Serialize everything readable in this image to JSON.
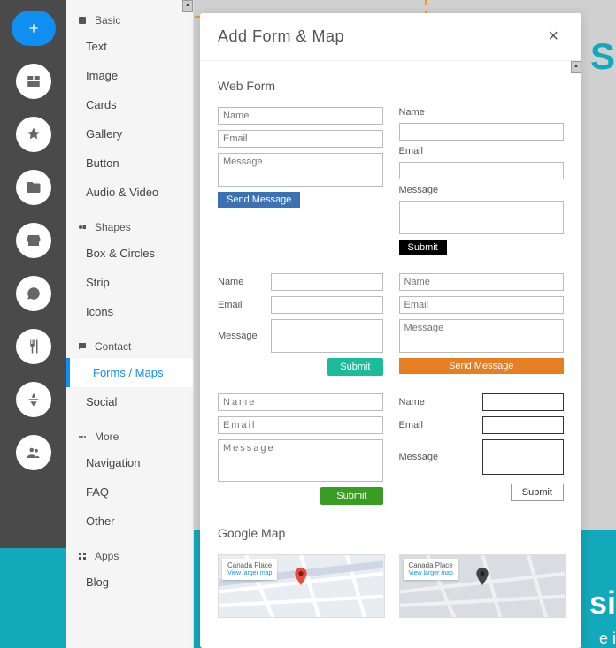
{
  "modal": {
    "title": "Add Form & Map",
    "close": "×",
    "section_webform": "Web Form",
    "section_map": "Google Map"
  },
  "form_labels": {
    "name": "Name",
    "email": "Email",
    "message": "Message",
    "send_message": "Send Message",
    "submit": "Submit"
  },
  "placeholders": {
    "name": "Name",
    "email": "Email",
    "message": "Message"
  },
  "map_card": {
    "place": "Canada Place",
    "view": "View larger map"
  },
  "sidebar": {
    "sections": [
      {
        "label": "Basic",
        "items": [
          {
            "label": "Text"
          },
          {
            "label": "Image"
          },
          {
            "label": "Cards"
          },
          {
            "label": "Gallery"
          },
          {
            "label": "Button"
          },
          {
            "label": "Audio & Video"
          }
        ]
      },
      {
        "label": "Shapes",
        "items": [
          {
            "label": "Box & Circles"
          },
          {
            "label": "Strip"
          },
          {
            "label": "Icons"
          }
        ]
      },
      {
        "label": "Contact",
        "items": [
          {
            "label": "Forms / Maps",
            "active": true
          },
          {
            "label": "Social"
          }
        ]
      },
      {
        "label": "More",
        "items": [
          {
            "label": "Navigation"
          },
          {
            "label": "FAQ"
          },
          {
            "label": "Other"
          }
        ]
      },
      {
        "label": "Apps",
        "items": [
          {
            "label": "Blog"
          }
        ]
      }
    ]
  },
  "bg": {
    "brand": "S",
    "hero": "si",
    "sub": "e i"
  }
}
